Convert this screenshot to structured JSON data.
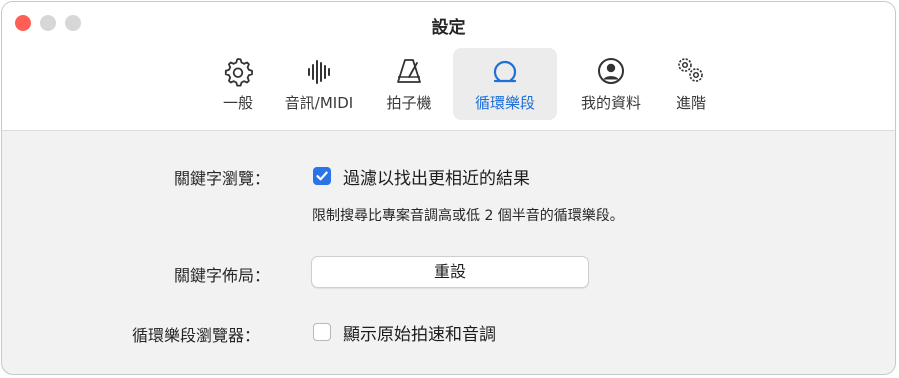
{
  "window": {
    "title": "設定"
  },
  "tabs": [
    {
      "label": "一般",
      "icon": "gear-icon"
    },
    {
      "label": "音訊/MIDI",
      "icon": "waveform-icon"
    },
    {
      "label": "拍子機",
      "icon": "metronome-icon"
    },
    {
      "label": "循環樂段",
      "icon": "loop-icon",
      "selected": true
    },
    {
      "label": "我的資料",
      "icon": "person-icon"
    },
    {
      "label": "進階",
      "icon": "gears-icon"
    }
  ],
  "settings": {
    "keyword_browser": {
      "label": "關鍵字瀏覽：",
      "checkbox_label": "過濾以找出更相近的結果",
      "checked": true,
      "hint": "限制搜尋比專案音調高或低 2 個半音的循環樂段。"
    },
    "keyword_layout": {
      "label": "關鍵字佈局：",
      "button_label": "重設"
    },
    "loop_browser": {
      "label": "循環樂段瀏覽器：",
      "checkbox_label": "顯示原始拍速和音調",
      "checked": false
    }
  },
  "colors": {
    "accent": "#2a73e8",
    "selected_tab_text": "#1f6fd8",
    "close": "#ff5f57"
  }
}
